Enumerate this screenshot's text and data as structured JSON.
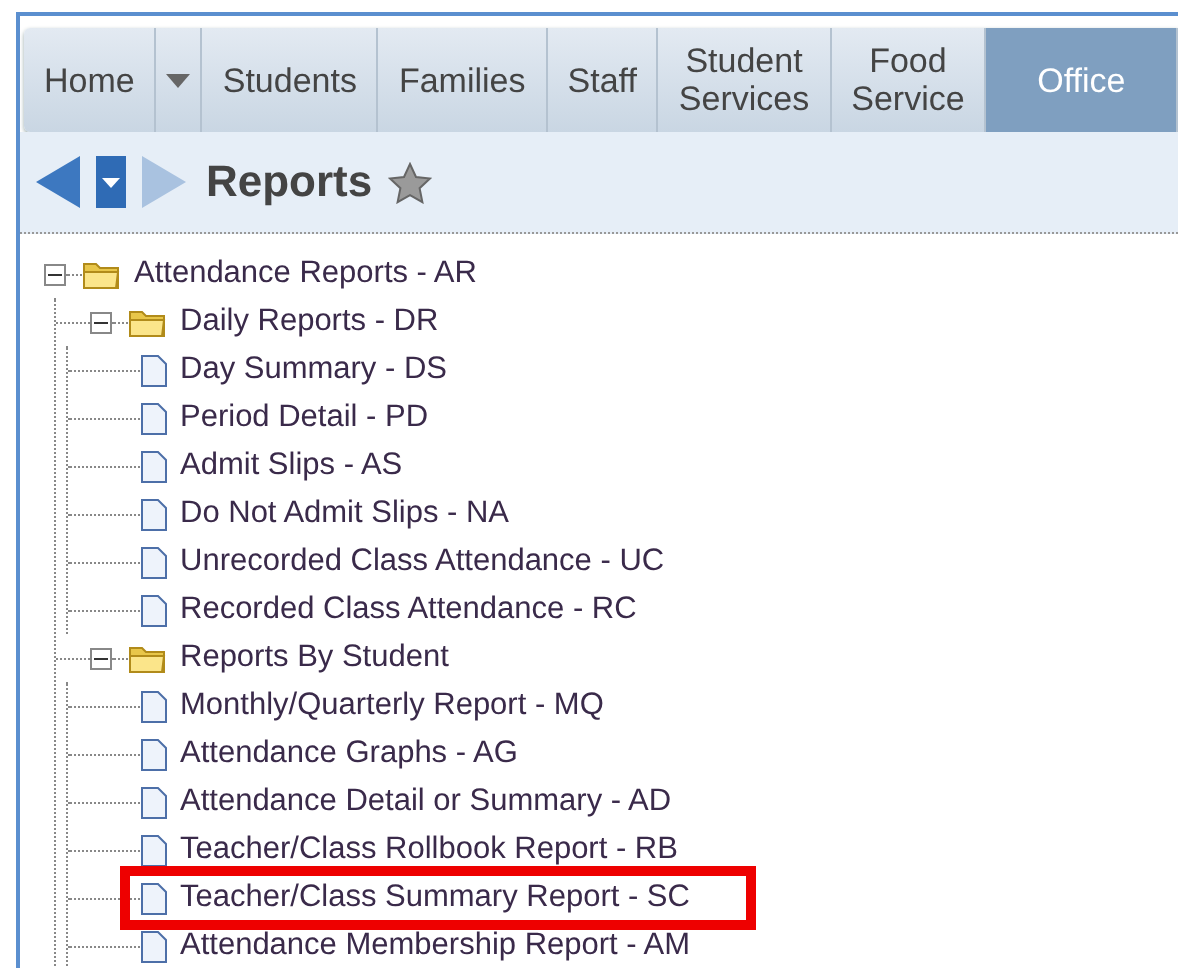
{
  "tabs": [
    {
      "kind": "tab",
      "label": "Home",
      "selected": false
    },
    {
      "kind": "caret",
      "selected": false
    },
    {
      "kind": "tab",
      "label": "Students",
      "selected": false
    },
    {
      "kind": "tab",
      "label": "Families",
      "selected": false
    },
    {
      "kind": "tab",
      "label": "Staff",
      "selected": false
    },
    {
      "kind": "tab",
      "label": "Student Services",
      "selected": false
    },
    {
      "kind": "tab",
      "label": "Food Service",
      "selected": false
    },
    {
      "kind": "tab",
      "label": "Office",
      "selected": true
    }
  ],
  "page": {
    "title": "Reports",
    "favorite": false
  },
  "tree": [
    {
      "kind": "folder",
      "label": "Attendance Reports - AR",
      "expanded": true,
      "children": [
        {
          "kind": "folder",
          "label": "Daily Reports - DR",
          "expanded": true,
          "children": [
            {
              "kind": "report",
              "label": "Day Summary - DS",
              "highlighted": false
            },
            {
              "kind": "report",
              "label": "Period Detail - PD",
              "highlighted": false
            },
            {
              "kind": "report",
              "label": "Admit Slips - AS",
              "highlighted": false
            },
            {
              "kind": "report",
              "label": "Do Not Admit Slips - NA",
              "highlighted": false
            },
            {
              "kind": "report",
              "label": "Unrecorded Class Attendance - UC",
              "highlighted": false
            },
            {
              "kind": "report",
              "label": "Recorded Class Attendance - RC",
              "highlighted": false
            }
          ]
        },
        {
          "kind": "folder",
          "label": "Reports By Student",
          "expanded": true,
          "children": [
            {
              "kind": "report",
              "label": "Monthly/Quarterly Report - MQ",
              "highlighted": false
            },
            {
              "kind": "report",
              "label": "Attendance Graphs - AG",
              "highlighted": false
            },
            {
              "kind": "report",
              "label": "Attendance Detail or Summary - AD",
              "highlighted": false
            },
            {
              "kind": "report",
              "label": "Teacher/Class Rollbook Report - RB",
              "highlighted": false
            },
            {
              "kind": "report",
              "label": "Teacher/Class Summary Report - SC",
              "highlighted": true
            },
            {
              "kind": "report",
              "label": "Attendance Membership Report - AM",
              "highlighted": false
            }
          ]
        }
      ]
    }
  ]
}
